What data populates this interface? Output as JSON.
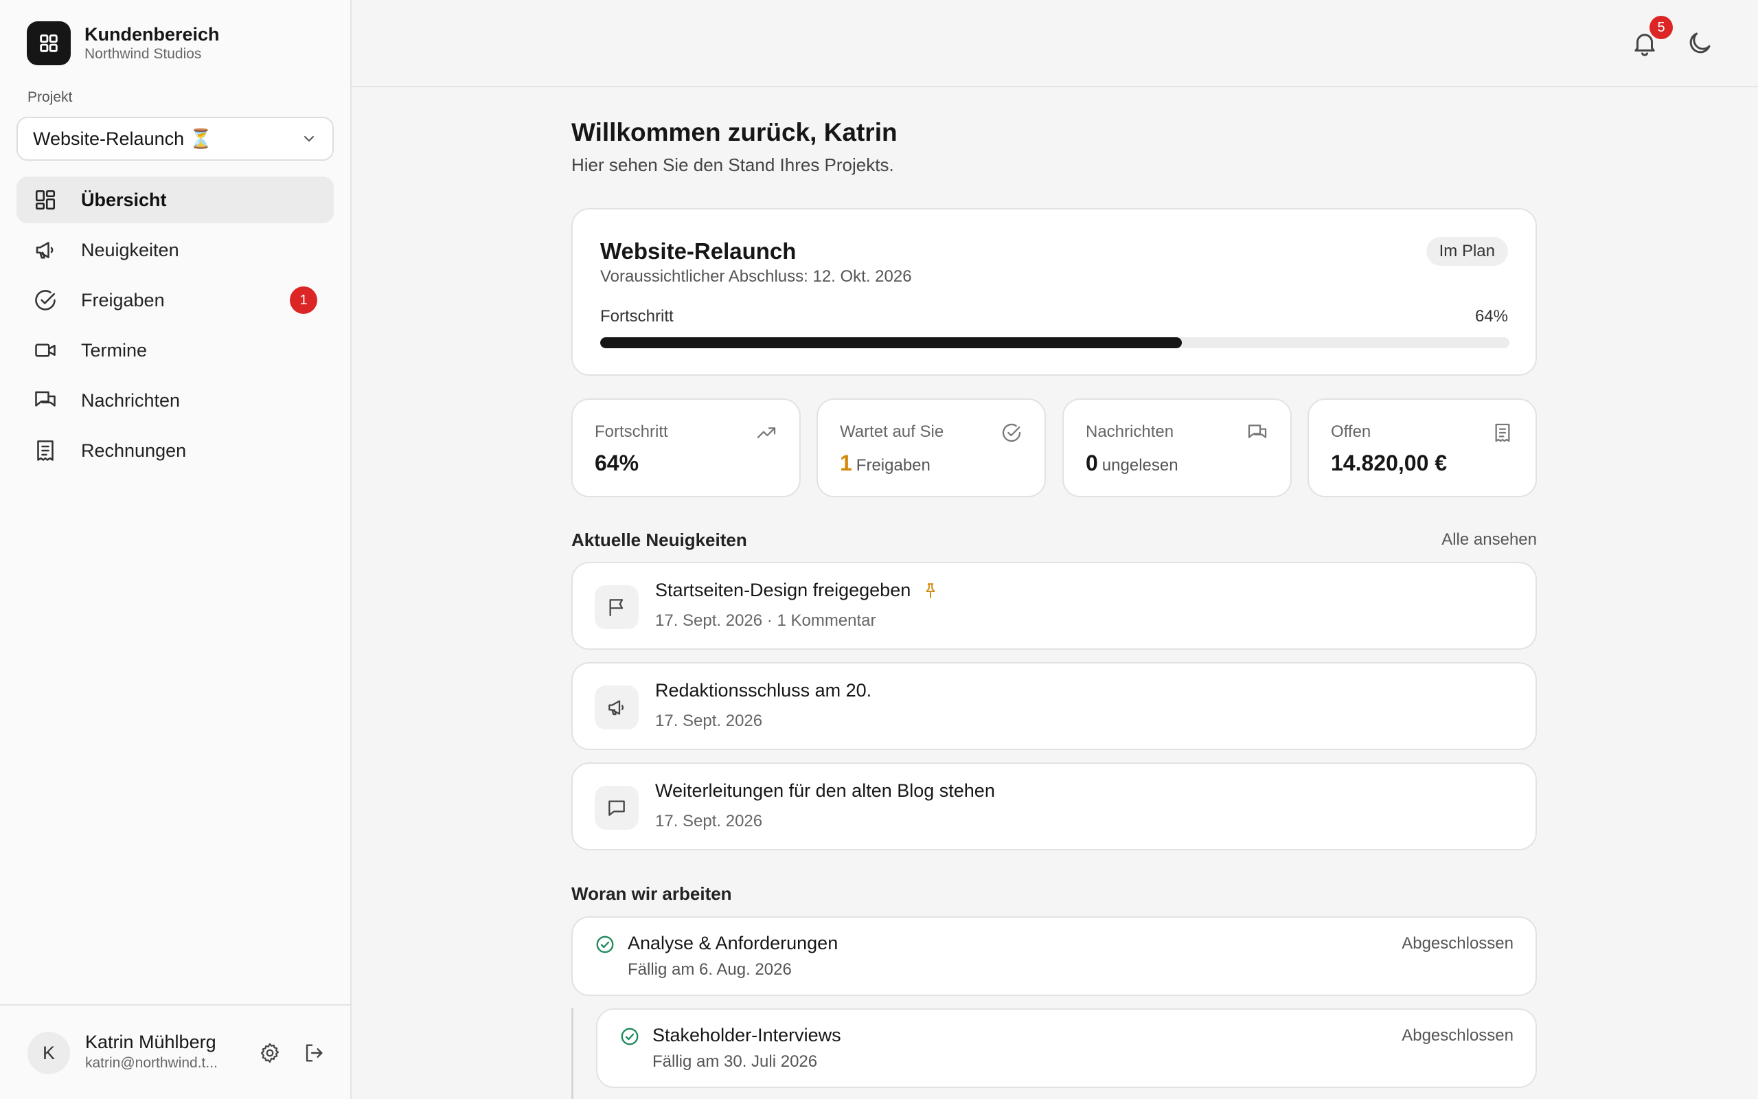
{
  "sidebar": {
    "brand_title": "Kundenbereich",
    "brand_sub": "Northwind Studios",
    "project_label": "Projekt",
    "project_value": "Website-Relaunch ⏳",
    "nav": [
      {
        "label": "Übersicht",
        "icon": "grid-icon",
        "active": true
      },
      {
        "label": "Neuigkeiten",
        "icon": "megaphone-icon"
      },
      {
        "label": "Freigaben",
        "icon": "check-circle-icon",
        "badge": "1"
      },
      {
        "label": "Termine",
        "icon": "video-icon"
      },
      {
        "label": "Nachrichten",
        "icon": "messages-icon"
      },
      {
        "label": "Rechnungen",
        "icon": "receipt-icon"
      }
    ],
    "user": {
      "initial": "K",
      "name": "Katrin Mühlberg",
      "email": "katrin@northwind.t..."
    }
  },
  "topbar": {
    "notification_count": "5"
  },
  "main": {
    "welcome": "Willkommen zurück, Katrin",
    "welcome_sub": "Hier sehen Sie den Stand Ihres Projekts.",
    "project_card": {
      "title": "Website-Relaunch",
      "subtitle": "Voraussichtlicher Abschluss: 12. Okt. 2026",
      "status": "Im Plan",
      "progress_label": "Fortschritt",
      "progress_text": "64%",
      "progress_value": 64
    },
    "stats": [
      {
        "label": "Fortschritt",
        "value": "64%",
        "suffix": "",
        "icon": "trending-up-icon"
      },
      {
        "label": "Wartet auf Sie",
        "value": "1",
        "suffix": "Freigaben",
        "icon": "check-circle-icon"
      },
      {
        "label": "Nachrichten",
        "value": "0",
        "suffix": "ungelesen",
        "icon": "messages-icon"
      },
      {
        "label": "Offen",
        "value": "14.820,00 €",
        "suffix": "",
        "icon": "receipt-icon"
      }
    ],
    "news_title": "Aktuelle Neuigkeiten",
    "news_link": "Alle ansehen",
    "news": [
      {
        "title": "Startseiten-Design freigegeben",
        "meta": "17. Sept. 2026 · 1 Kommentar",
        "icon": "flag-icon",
        "pinned": true
      },
      {
        "title": "Redaktionsschluss am 20.",
        "meta": "17. Sept. 2026",
        "icon": "megaphone-icon"
      },
      {
        "title": "Weiterleitungen für den alten Blog stehen",
        "meta": "17. Sept. 2026",
        "icon": "message-icon"
      }
    ],
    "work_title": "Woran wir arbeiten",
    "work": [
      {
        "title": "Analyse & Anforderungen",
        "date": "Fällig am 6. Aug. 2026",
        "status": "Abgeschlossen"
      },
      {
        "title": "Stakeholder-Interviews",
        "date": "Fällig am 30. Juli 2026",
        "status": "Abgeschlossen"
      }
    ]
  }
}
